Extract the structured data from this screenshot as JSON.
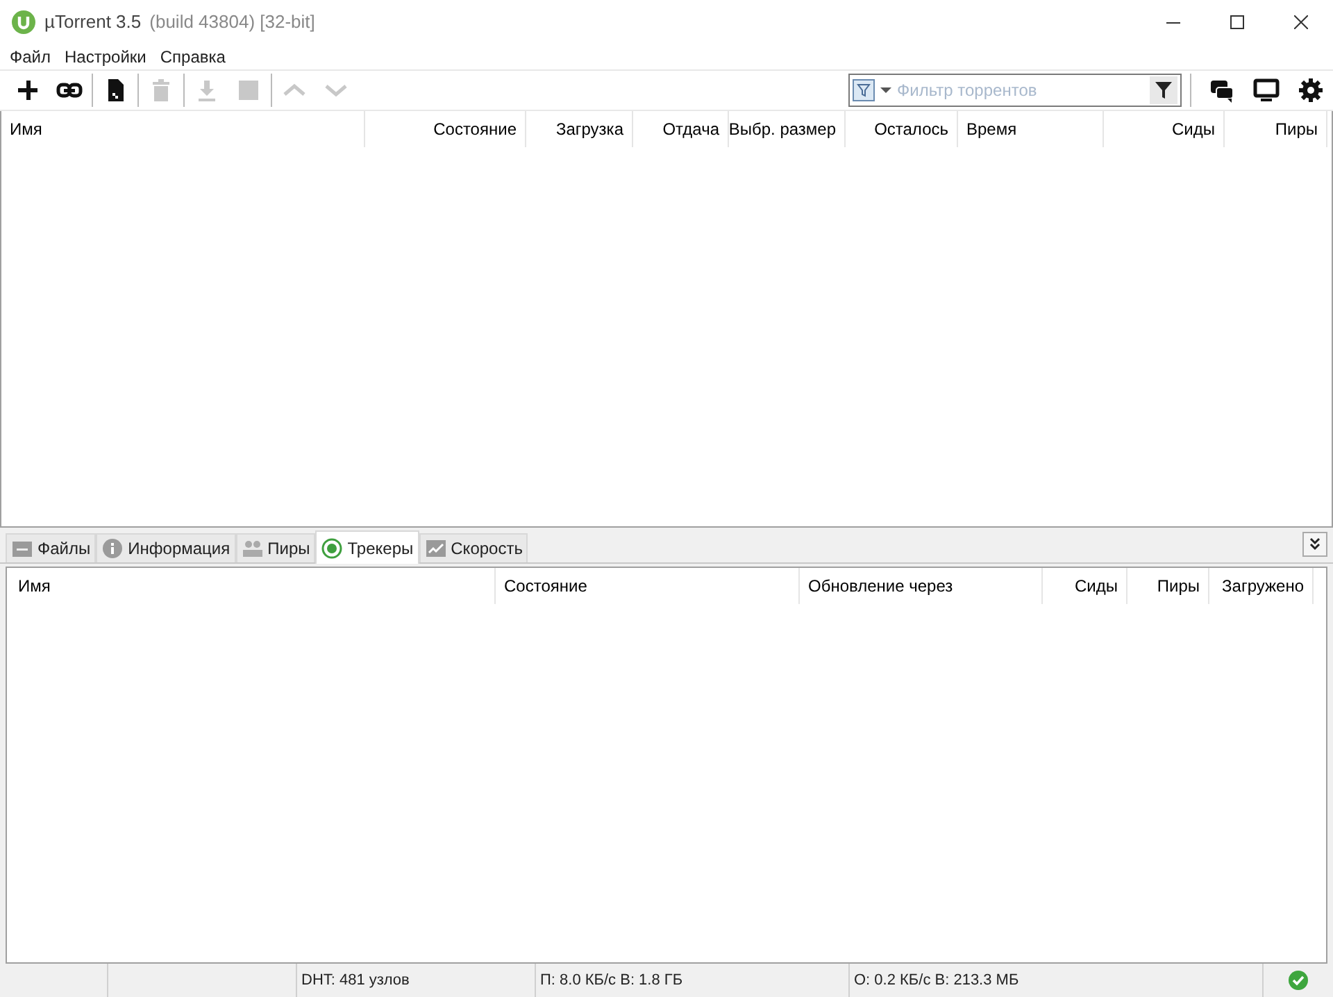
{
  "window": {
    "title": "µTorrent 3.5",
    "subtitle": "(build 43804) [32-bit]"
  },
  "menu": [
    "Файл",
    "Настройки",
    "Справка"
  ],
  "toolbar": [
    {
      "kind": "add",
      "disabled": false
    },
    {
      "kind": "link",
      "disabled": false
    },
    {
      "kind": "create",
      "disabled": false
    },
    {
      "kind": "delete",
      "disabled": true
    },
    {
      "kind": "download",
      "disabled": true
    },
    {
      "kind": "stop",
      "disabled": true
    },
    {
      "kind": "up",
      "disabled": true
    },
    {
      "kind": "down",
      "disabled": true
    }
  ],
  "filter": {
    "placeholder": "Фильтр торрентов"
  },
  "right_tools": [
    {
      "kind": "chat"
    },
    {
      "kind": "remote"
    },
    {
      "kind": "settings"
    }
  ],
  "torrent_table": {
    "columns": [
      "Имя",
      "Состояние",
      "Загрузка",
      "Отдача",
      "Выбр. размер",
      "Осталось",
      "Время",
      "Сиды",
      "Пиры"
    ]
  },
  "tabs": [
    {
      "label": "Файлы",
      "kind": "files",
      "selected": false
    },
    {
      "label": "Информация",
      "kind": "info",
      "selected": false
    },
    {
      "label": "Пиры",
      "kind": "peers",
      "selected": false
    },
    {
      "label": "Трекеры",
      "kind": "trackers",
      "selected": true
    },
    {
      "label": "Скорость",
      "kind": "speed",
      "selected": false
    }
  ],
  "tracker_table": {
    "columns": [
      "Имя",
      "Состояние",
      "Обновление через",
      "Сиды",
      "Пиры",
      "Загружено"
    ]
  },
  "status_bar": {
    "dht": "DHT: 481 узлов",
    "download": "П: 8.0 КБ/с В: 1.8 ГБ",
    "upload": "О: 0.2 КБ/с В: 213.3 МБ",
    "ok": true
  }
}
